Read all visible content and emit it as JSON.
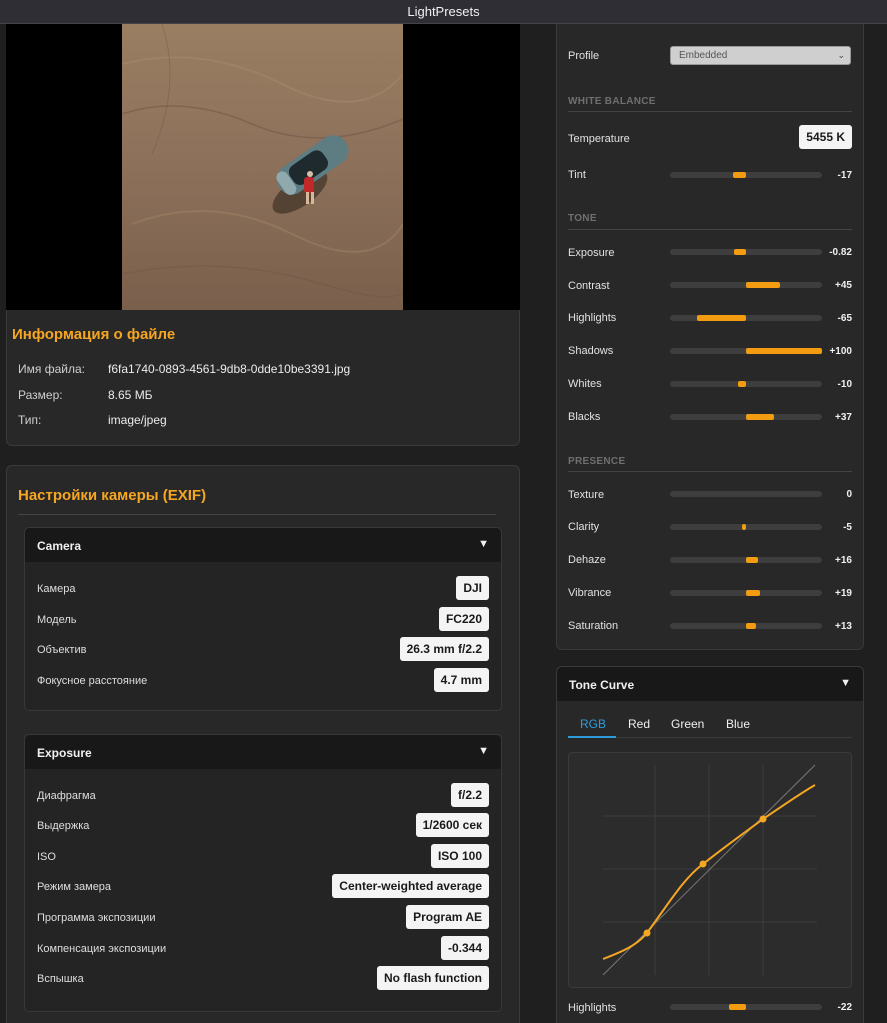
{
  "window": {
    "title": "LightPresets"
  },
  "file_info": {
    "title": "Информация о файле",
    "rows": [
      {
        "label": "Имя файла:",
        "value": "f6fa1740-0893-4561-9db8-0dde10be3391.jpg"
      },
      {
        "label": "Размер:",
        "value": "8.65 МБ"
      },
      {
        "label": "Тип:",
        "value": "image/jpeg"
      }
    ]
  },
  "exif": {
    "title": "Настройки камеры (EXIF)",
    "camera": {
      "header": "Camera",
      "chevron": "▼",
      "rows": [
        {
          "label": "Камера",
          "value": "DJI"
        },
        {
          "label": "Модель",
          "value": "FC220"
        },
        {
          "label": "Объектив",
          "value": "26.3 mm f/2.2"
        },
        {
          "label": "Фокусное расстояние",
          "value": "4.7 mm"
        }
      ]
    },
    "exposure": {
      "header": "Exposure",
      "chevron": "▼",
      "rows": [
        {
          "label": "Диафрагма",
          "value": "f/2.2"
        },
        {
          "label": "Выдержка",
          "value": "1/2600 сек"
        },
        {
          "label": "ISO",
          "value": "ISO 100"
        },
        {
          "label": "Режим замера",
          "value": "Center-weighted average"
        },
        {
          "label": "Программа экспозиции",
          "value": "Program AE"
        },
        {
          "label": "Компенсация экспозиции",
          "value": "-0.344"
        },
        {
          "label": "Вспышка",
          "value": "No flash function"
        }
      ]
    }
  },
  "develop": {
    "profile": {
      "label": "Profile",
      "value": "Embedded"
    },
    "white_balance": {
      "title": "WHITE BALANCE",
      "temperature": {
        "label": "Temperature",
        "value": "5455 K"
      },
      "tint": {
        "label": "Tint",
        "value": "-17",
        "amount": -17
      }
    },
    "tone": {
      "title": "TONE",
      "sliders": [
        {
          "label": "Exposure",
          "value": "-0.82",
          "amount": -16
        },
        {
          "label": "Contrast",
          "value": "+45",
          "amount": 45
        },
        {
          "label": "Highlights",
          "value": "-65",
          "amount": -65
        },
        {
          "label": "Shadows",
          "value": "+100",
          "amount": 100
        },
        {
          "label": "Whites",
          "value": "-10",
          "amount": -10
        },
        {
          "label": "Blacks",
          "value": "+37",
          "amount": 37
        }
      ]
    },
    "presence": {
      "title": "PRESENCE",
      "sliders": [
        {
          "label": "Texture",
          "value": "0",
          "amount": 0
        },
        {
          "label": "Clarity",
          "value": "-5",
          "amount": -5
        },
        {
          "label": "Dehaze",
          "value": "+16",
          "amount": 16
        },
        {
          "label": "Vibrance",
          "value": "+19",
          "amount": 19
        },
        {
          "label": "Saturation",
          "value": "+13",
          "amount": 13
        }
      ]
    },
    "tone_curve": {
      "header": "Tone Curve",
      "chevron": "▼",
      "tabs": [
        "RGB",
        "Red",
        "Green",
        "Blue"
      ],
      "active_tab": "RGB",
      "highlights": {
        "label": "Highlights",
        "value": "-22",
        "amount": -22
      }
    }
  },
  "colors": {
    "accent": "#f5a623",
    "slider_fill": "#f39c12",
    "tab_active": "#2d9cdb"
  }
}
